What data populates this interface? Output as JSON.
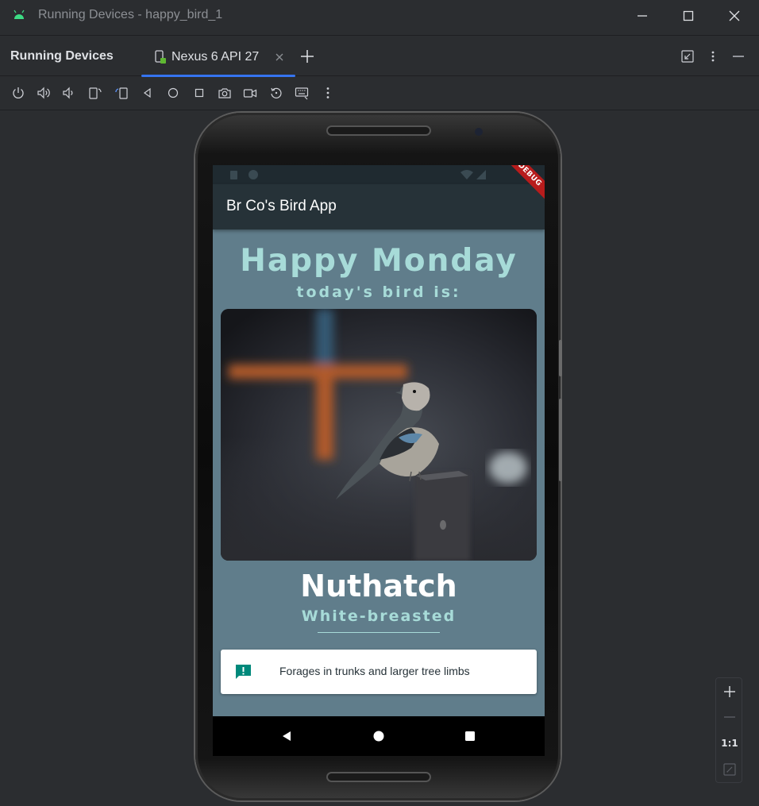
{
  "window": {
    "title": "Running Devices - happy_bird_1"
  },
  "tool_window": {
    "title": "Running Devices",
    "tab_label": "Nexus 6 API 27"
  },
  "device_toolbar": {
    "icons": [
      "power-icon",
      "volume-up-icon",
      "volume-down-icon",
      "rotate-left-icon",
      "rotate-right-icon",
      "back-icon",
      "home-icon",
      "overview-icon",
      "screenshot-icon",
      "screen-record-icon",
      "reset-icon",
      "keyboard-icon",
      "more-icon"
    ]
  },
  "app": {
    "title": "Br Co's Bird App",
    "debug_banner": "DEBUG",
    "greeting": "Happy Monday",
    "subtitle": "today's bird is:",
    "bird_name": "Nuthatch",
    "bird_variety": "White-breasted",
    "fact": "Forages in trunks and larger tree limbs",
    "colors": {
      "background": "#607d8b",
      "appbar": "#263238",
      "accent": "#a7dbd8",
      "fact_icon": "#00897b"
    }
  },
  "zoom": {
    "actual_size_label": "1:1"
  }
}
